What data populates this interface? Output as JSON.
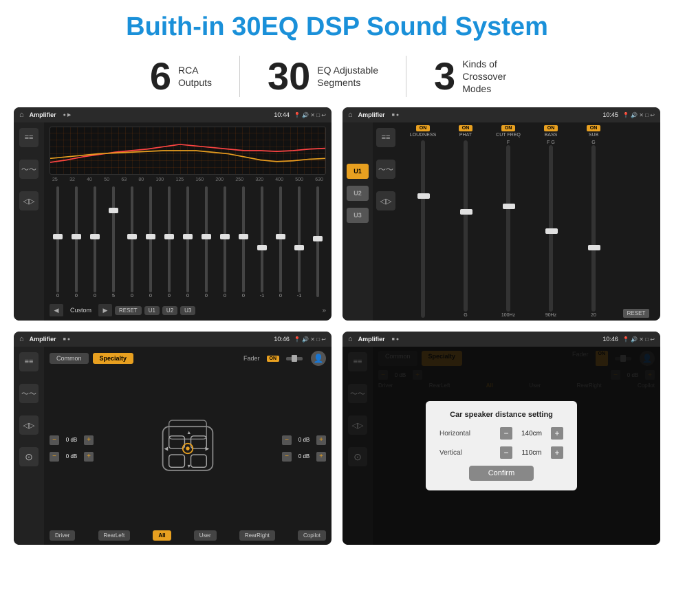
{
  "header": {
    "title": "Buith-in 30EQ DSP Sound System"
  },
  "stats": [
    {
      "number": "6",
      "label": "RCA\nOutputs"
    },
    {
      "number": "30",
      "label": "EQ Adjustable\nSegments"
    },
    {
      "number": "3",
      "label": "Kinds of\nCrossover Modes"
    }
  ],
  "screens": [
    {
      "id": "screen1",
      "statusBar": {
        "title": "Amplifier",
        "time": "10:44"
      },
      "description": "30-band EQ screen"
    },
    {
      "id": "screen2",
      "statusBar": {
        "title": "Amplifier",
        "time": "10:45"
      },
      "description": "Crossover modes U1/U2/U3"
    },
    {
      "id": "screen3",
      "statusBar": {
        "title": "Amplifier",
        "time": "10:46"
      },
      "description": "Speaker fader control"
    },
    {
      "id": "screen4",
      "statusBar": {
        "title": "Amplifier",
        "time": "10:46"
      },
      "description": "Speaker distance setting dialog",
      "dialog": {
        "title": "Car speaker distance setting",
        "horizontal": {
          "label": "Horizontal",
          "value": "140cm"
        },
        "vertical": {
          "label": "Vertical",
          "value": "110cm"
        },
        "confirmLabel": "Confirm"
      }
    }
  ],
  "eq": {
    "frequencies": [
      "25",
      "32",
      "40",
      "50",
      "63",
      "80",
      "100",
      "125",
      "160",
      "200",
      "250",
      "320",
      "400",
      "500",
      "630"
    ],
    "values": [
      "0",
      "0",
      "0",
      "5",
      "0",
      "0",
      "0",
      "0",
      "0",
      "0",
      "0",
      "-1",
      "0",
      "-1",
      ""
    ],
    "presets": [
      "Custom",
      "RESET",
      "U1",
      "U2",
      "U3"
    ]
  },
  "channels": {
    "labels": [
      "LOUDNESS",
      "PHAT",
      "CUT FREQ",
      "BASS",
      "SUB"
    ]
  },
  "zones": {
    "buttons": [
      "Driver",
      "RearLeft",
      "All",
      "User",
      "RearRight",
      "Copilot"
    ]
  }
}
